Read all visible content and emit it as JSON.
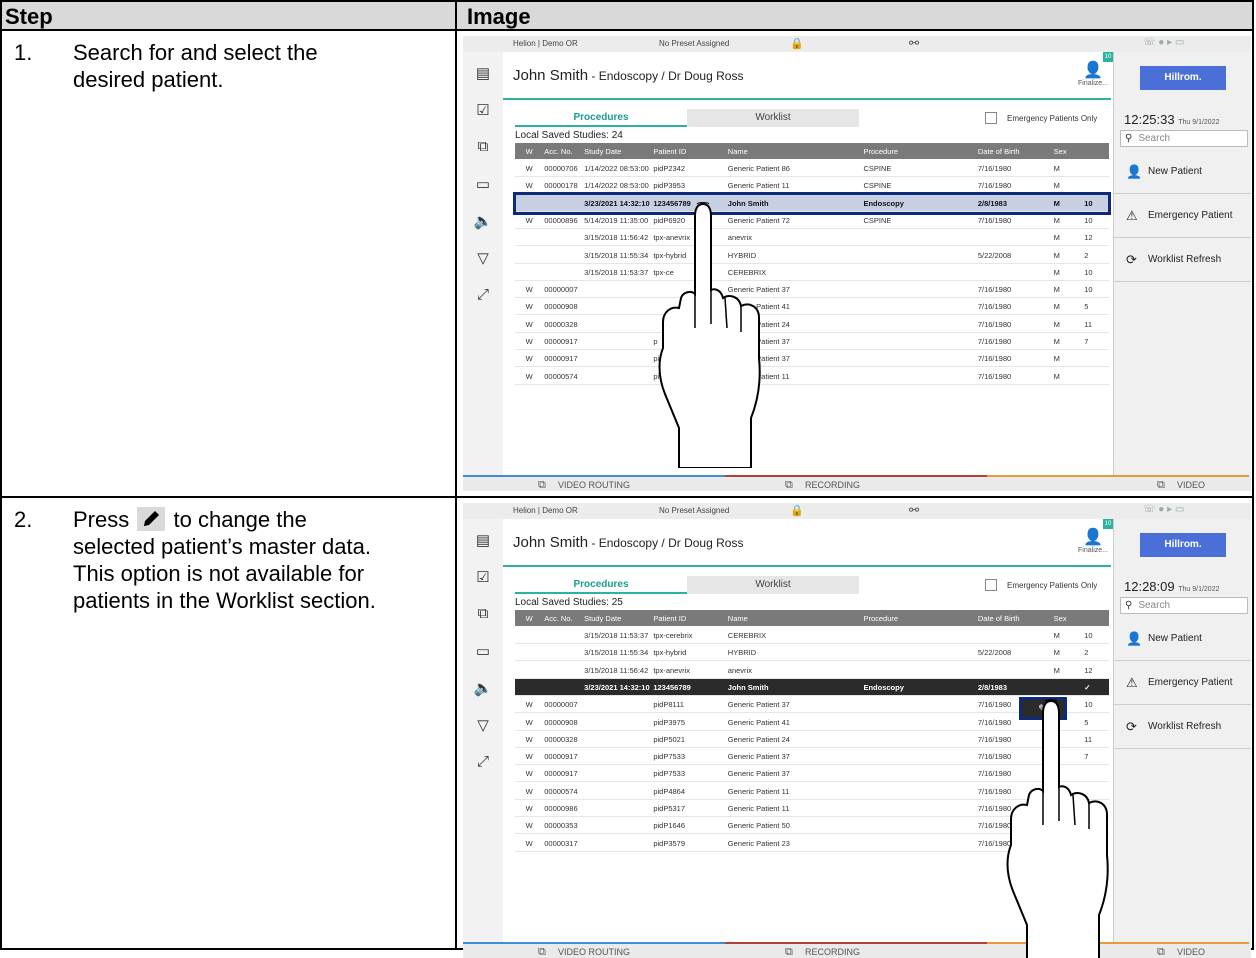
{
  "header": {
    "step": "Step",
    "image": "Image"
  },
  "steps": [
    {
      "num": "1.",
      "text_lines": [
        "Search for and select the",
        "desired patient."
      ]
    },
    {
      "num": "2.",
      "text_before_icon": "Press",
      "text_after_icon": "to change the",
      "text_lines": [
        "selected patient’s master data.",
        "This option is not available for",
        "patients in the Worklist section."
      ]
    }
  ],
  "screens": [
    {
      "topbar": {
        "location": "Helion | Demo OR",
        "preset": "No Preset Assigned"
      },
      "patient_name": "John Smith",
      "patient_detail": " - Endoscopy / Dr Doug Ross",
      "finalize": "Finalize...",
      "badge": "10",
      "logo": "Hillrom.",
      "clock": "12:25:33",
      "date": "Thu 9/1/2022",
      "search_placeholder": "Search",
      "right_buttons": [
        "New Patient",
        "Emergency Patient",
        "Worklist Refresh"
      ],
      "tabs": [
        "Procedures",
        "Worklist"
      ],
      "emergency_only": "Emergency Patients Only",
      "studies_label": "Local Saved Studies: 24",
      "columns": [
        "W",
        "Acc. No.",
        "Study Date",
        "Patient ID",
        "Name",
        "Procedure",
        "Date of Birth",
        "Sex",
        ""
      ],
      "rows": [
        [
          "W",
          "00000706",
          "1/14/2022 08:53:00",
          "pidP2342",
          "Generic Patient 86",
          "CSPINE",
          "7/16/1980",
          "M",
          ""
        ],
        [
          "W",
          "00000178",
          "1/14/2022 08:53:00",
          "pidP3953",
          "Generic Patient 11",
          "CSPINE",
          "7/16/1980",
          "M",
          ""
        ],
        [
          "",
          "",
          "3/23/2021 14:32:10",
          "123456789",
          "John Smith",
          "Endoscopy",
          "2/8/1983",
          "M",
          "10"
        ],
        [
          "W",
          "00000896",
          "5/14/2019 11:35:00",
          "pidP6920",
          "Generic Patient 72",
          "CSPINE",
          "7/16/1980",
          "M",
          "10"
        ],
        [
          "",
          "",
          "3/15/2018 11:56:42",
          "tpx-anevrix",
          "anevrix",
          "",
          "",
          "M",
          "12"
        ],
        [
          "",
          "",
          "3/15/2018 11:55:34",
          "tpx-hybrid",
          "HYBRID",
          "",
          "5/22/2008",
          "M",
          "2"
        ],
        [
          "",
          "",
          "3/15/2018 11:53:37",
          "tpx-ce",
          "CEREBRIX",
          "",
          "",
          "M",
          "10"
        ],
        [
          "W",
          "00000007",
          "",
          "",
          "Generic Patient 37",
          "",
          "7/16/1980",
          "M",
          "10"
        ],
        [
          "W",
          "00000908",
          "",
          "",
          "Generic Patient 41",
          "",
          "7/16/1980",
          "M",
          "5"
        ],
        [
          "W",
          "00000328",
          "",
          "",
          "Generic Patient 24",
          "",
          "7/16/1980",
          "M",
          "11"
        ],
        [
          "W",
          "00000917",
          "",
          "p",
          "Generic Patient 37",
          "",
          "7/16/1980",
          "M",
          "7"
        ],
        [
          "W",
          "00000917",
          "",
          "pid",
          "Generic Patient 37",
          "",
          "7/16/1980",
          "M",
          ""
        ],
        [
          "W",
          "00000574",
          "",
          "pid",
          "Generic Patient 11",
          "",
          "7/16/1980",
          "M",
          ""
        ]
      ],
      "selected_row": 2,
      "bottom": [
        "VIDEO ROUTING",
        "RECORDING",
        "VIDEO CONFERENCE"
      ]
    },
    {
      "topbar": {
        "location": "Helion | Demo OR",
        "preset": "No Preset Assigned"
      },
      "patient_name": "John Smith",
      "patient_detail": " - Endoscopy / Dr Doug Ross",
      "finalize": "Finalize...",
      "badge": "10",
      "logo": "Hillrom.",
      "clock": "12:28:09",
      "date": "Thu 9/1/2022",
      "search_placeholder": "Search",
      "right_buttons": [
        "New Patient",
        "Emergency Patient",
        "Worklist Refresh"
      ],
      "tabs": [
        "Procedures",
        "Worklist"
      ],
      "emergency_only": "Emergency Patients Only",
      "studies_label": "Local Saved Studies: 25",
      "columns": [
        "W",
        "Acc. No.",
        "Study Date",
        "Patient ID",
        "Name",
        "Procedure",
        "Date of Birth",
        "Sex",
        ""
      ],
      "rows": [
        [
          "",
          "",
          "3/15/2018 11:53:37",
          "tpx-cerebrix",
          "CEREBRIX",
          "",
          "",
          "M",
          "10"
        ],
        [
          "",
          "",
          "3/15/2018 11:55:34",
          "tpx-hybrid",
          "HYBRID",
          "",
          "5/22/2008",
          "M",
          "2"
        ],
        [
          "",
          "",
          "3/15/2018 11:56:42",
          "tpx-anevrix",
          "anevrix",
          "",
          "",
          "M",
          "12"
        ],
        [
          "",
          "",
          "3/23/2021 14:32:10",
          "123456789",
          "John Smith",
          "Endoscopy",
          "2/8/1983",
          "",
          "✓"
        ],
        [
          "W",
          "00000007",
          "",
          "pidP8111",
          "Generic Patient 37",
          "",
          "7/16/1980",
          "",
          "10"
        ],
        [
          "W",
          "00000908",
          "",
          "pidP3975",
          "Generic Patient 41",
          "",
          "7/16/1980",
          "",
          "5"
        ],
        [
          "W",
          "00000328",
          "",
          "pidP5021",
          "Generic Patient 24",
          "",
          "7/16/1980",
          "",
          "11"
        ],
        [
          "W",
          "00000917",
          "",
          "pidP7533",
          "Generic Patient 37",
          "",
          "7/16/1980",
          "",
          "7"
        ],
        [
          "W",
          "00000917",
          "",
          "pidP7533",
          "Generic Patient 37",
          "",
          "7/16/1980",
          "",
          ""
        ],
        [
          "W",
          "00000574",
          "",
          "pidP4864",
          "Generic Patient 11",
          "",
          "7/16/1980",
          "",
          ""
        ],
        [
          "W",
          "00000986",
          "",
          "pidP5317",
          "Generic Patient 11",
          "",
          "7/16/1980",
          "",
          "3"
        ],
        [
          "W",
          "00000353",
          "",
          "pidP1646",
          "Generic Patient 50",
          "",
          "7/16/1980",
          "",
          "7"
        ],
        [
          "W",
          "00000317",
          "",
          "pidP3579",
          "Generic Patient 23",
          "",
          "7/16/1980",
          "",
          ""
        ]
      ],
      "selected_row": 3,
      "bottom": [
        "VIDEO ROUTING",
        "RECORDING",
        "VIDEO CONFERENCE"
      ]
    }
  ]
}
